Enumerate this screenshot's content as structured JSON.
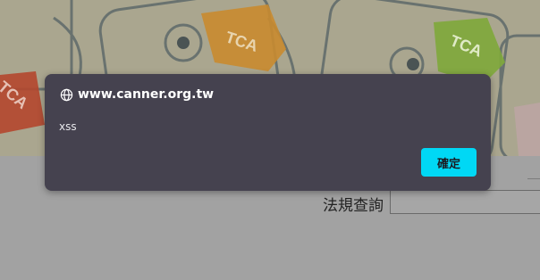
{
  "dialog": {
    "origin": "www.canner.org.tw",
    "origin_icon": "globe-icon",
    "message": "xss",
    "ok_label": "確定",
    "ok_color": "#00d8f5",
    "background_color": "#45424f"
  },
  "banner": {
    "tags": [
      "TCA",
      "TCA",
      "TCA"
    ]
  },
  "search": {
    "label": "法規查詢",
    "value": ""
  }
}
